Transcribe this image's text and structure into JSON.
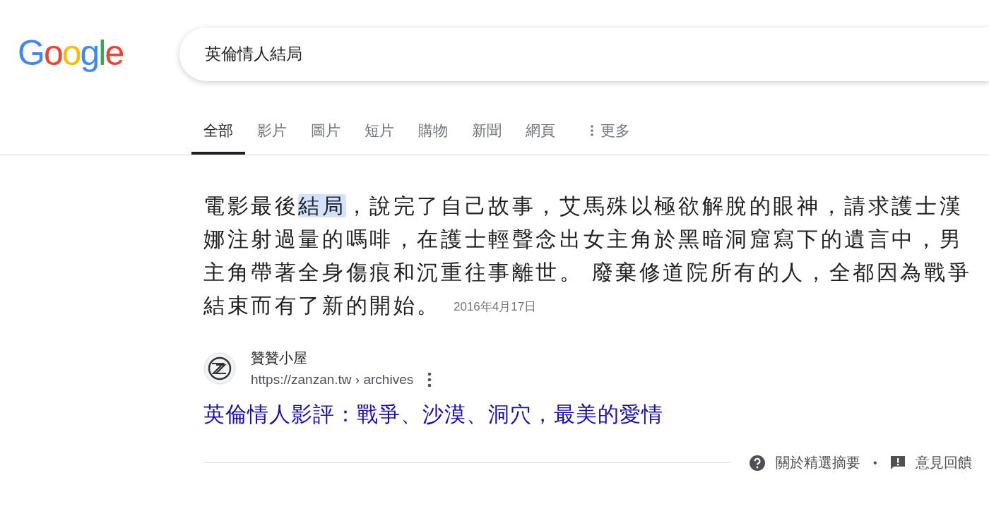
{
  "logo": {
    "text": "Google"
  },
  "search": {
    "value": "英倫情人結局"
  },
  "tabs": [
    {
      "label": "全部",
      "selected": true
    },
    {
      "label": "影片",
      "selected": false
    },
    {
      "label": "圖片",
      "selected": false
    },
    {
      "label": "短片",
      "selected": false
    },
    {
      "label": "購物",
      "selected": false
    },
    {
      "label": "新聞",
      "selected": false
    },
    {
      "label": "網頁",
      "selected": false
    },
    {
      "label": "更多",
      "selected": false,
      "kind": "more"
    }
  ],
  "snippet": {
    "parts": [
      {
        "text": "電影最後",
        "highlighted": false
      },
      {
        "text": "結局",
        "highlighted": true
      },
      {
        "text": "，說完了自己故事，艾馬殊以極欲解脫的眼神，請求護士漢娜注射過量的嗎啡，在護士輕聲念出女主角於黑暗洞窟寫下的遺言中，男主角帶著全身傷痕和沉重往事離世。 廢棄修道院所有的人，全都因為戰爭結束而有了新的開始。",
        "highlighted": false
      }
    ],
    "date": "2016年4月17日"
  },
  "source": {
    "site_name": "贊贊小屋",
    "url": "https://zanzan.tw › archives",
    "title": "英倫情人影評：戰爭、沙漠、洞穴，最美的愛情"
  },
  "footer": {
    "about": "關於精選摘要",
    "separator": "•",
    "feedback": "意見回饋"
  }
}
